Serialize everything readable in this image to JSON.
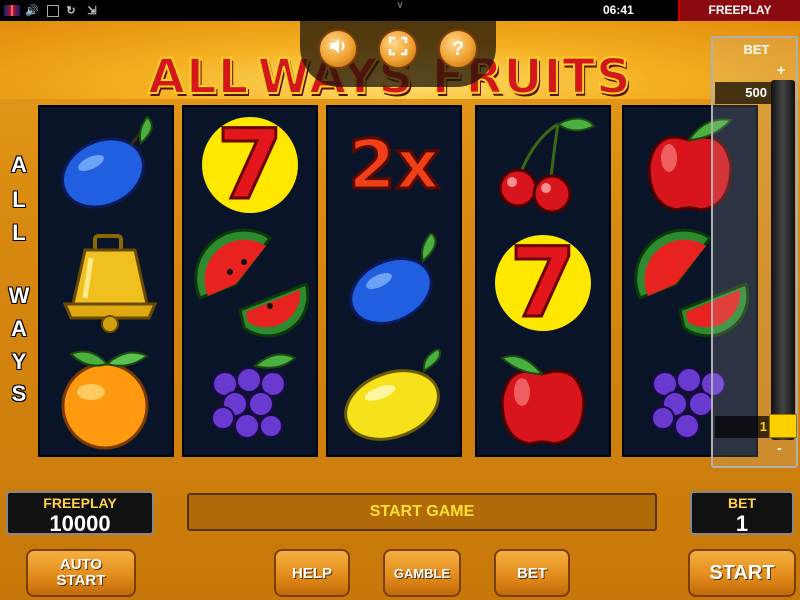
{
  "topbar": {
    "time": "06:41",
    "freeplay_label": "FREEPLAY"
  },
  "banner": {
    "title_part1": "ALL",
    "title_part2": "WAYS FRUITS"
  },
  "side_text": [
    "A",
    "L",
    "L",
    "W",
    "A",
    "Y",
    "S"
  ],
  "reels": [
    [
      "plum",
      "bell",
      "orange"
    ],
    [
      "seven",
      "watermelon",
      "grapes"
    ],
    [
      "2x",
      "plum",
      "lemon"
    ],
    [
      "cherry",
      "seven",
      "apple"
    ],
    [
      "apple",
      "watermelon",
      "grapes"
    ]
  ],
  "multiplier_text": "2x",
  "seven_text": "7",
  "bet_panel": {
    "label": "BET",
    "max_value": "500",
    "current_value": "1",
    "plus": "+",
    "minus": "-"
  },
  "bottom": {
    "freeplay_label": "FREEPLAY",
    "freeplay_value": "10000",
    "message": "START GAME",
    "bet_label": "BET",
    "bet_value": "1"
  },
  "buttons": {
    "auto_start": "AUTO START",
    "help": "HELP",
    "gamble": "GAMBLE",
    "bet": "BET",
    "start": "START"
  },
  "icons": {
    "sound": "speaker-icon",
    "fullscreen": "fullscreen-icon",
    "help": "question-icon"
  },
  "help_glyph": "?"
}
